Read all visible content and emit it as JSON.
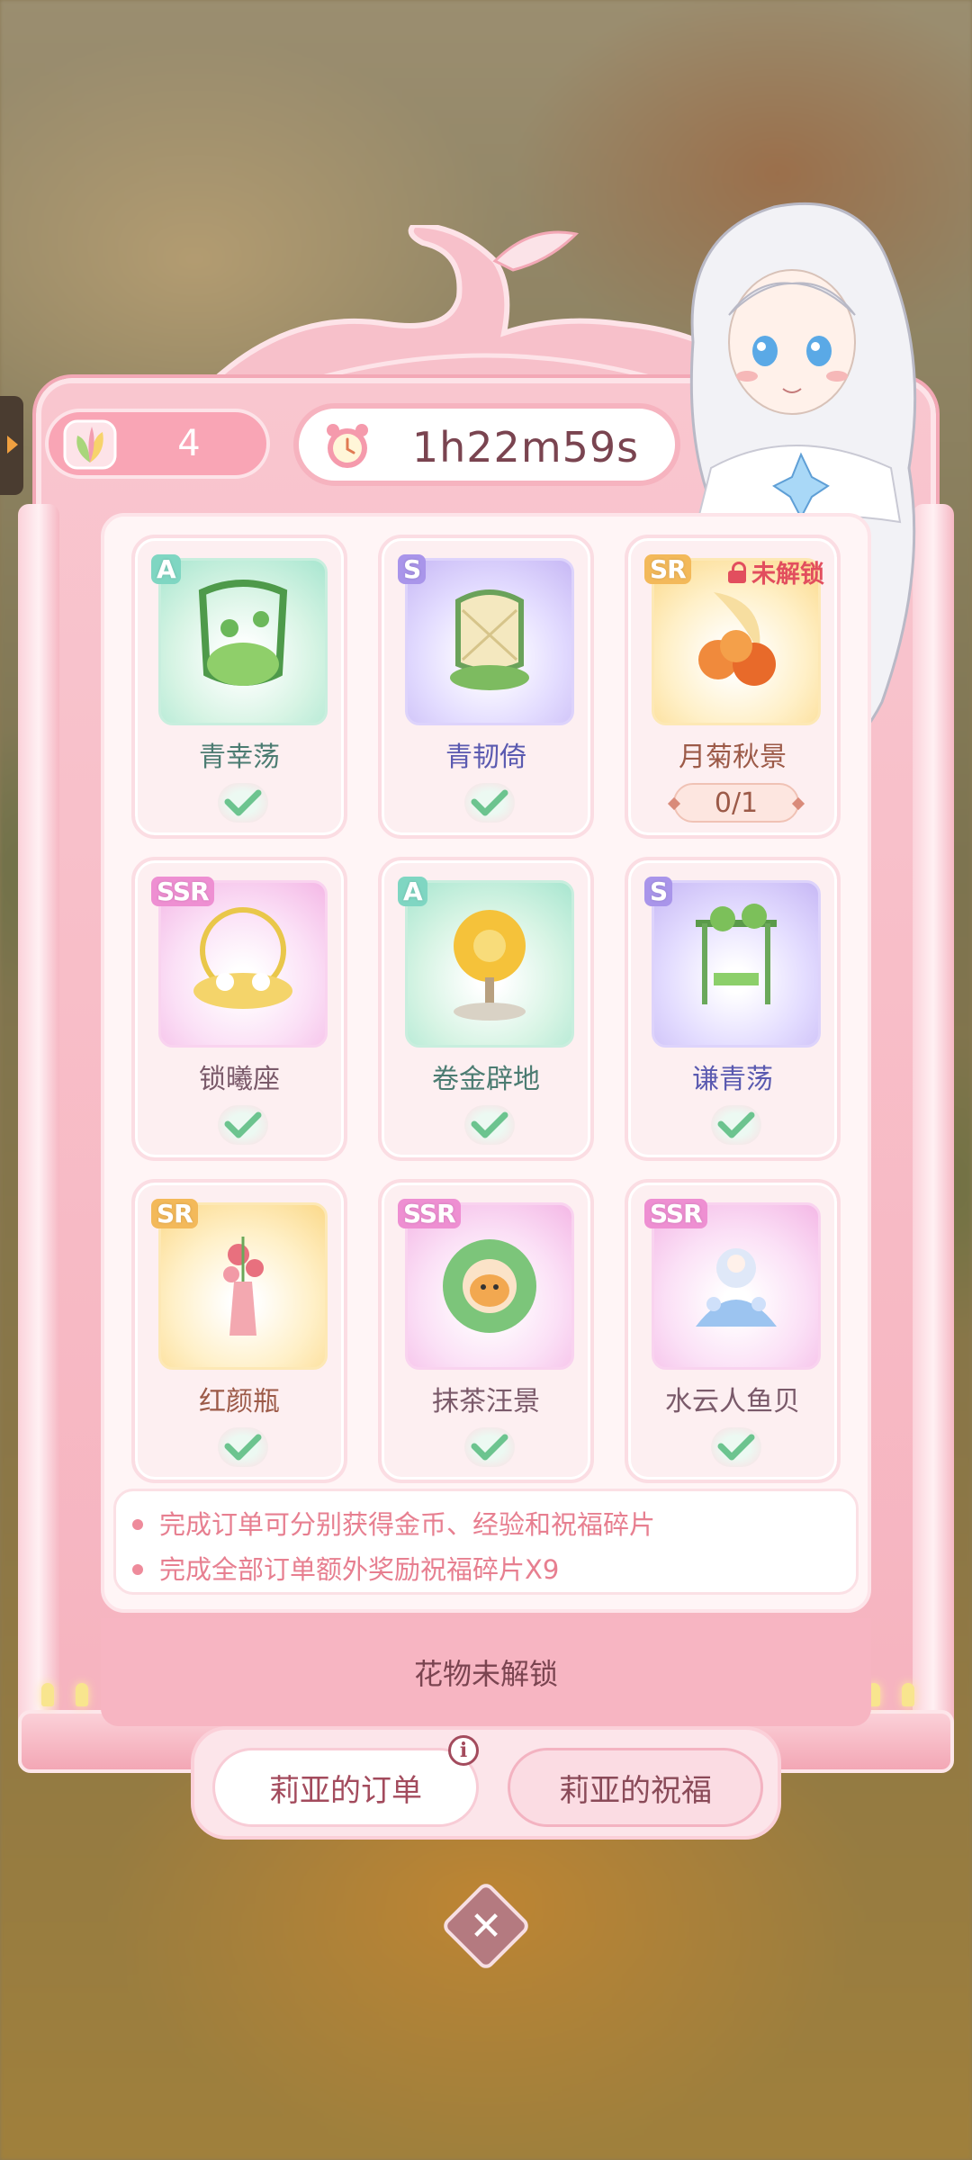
{
  "top_bar": {
    "petal_count": "4",
    "timer": "1h22m59s"
  },
  "orders": [
    {
      "rarity": "A",
      "name": "青幸荡",
      "status": "done",
      "progress": ""
    },
    {
      "rarity": "S",
      "name": "青韧倚",
      "status": "done",
      "progress": ""
    },
    {
      "rarity": "SR",
      "name": "月菊秋景",
      "status": "locked",
      "lock_label": "未解锁",
      "progress": "0/1"
    },
    {
      "rarity": "SSR",
      "name": "锁曦座",
      "status": "done",
      "progress": ""
    },
    {
      "rarity": "A",
      "name": "卷金辟地",
      "status": "done",
      "progress": ""
    },
    {
      "rarity": "S",
      "name": "谦青荡",
      "status": "done",
      "progress": ""
    },
    {
      "rarity": "SR",
      "name": "红颜瓶",
      "status": "done",
      "progress": ""
    },
    {
      "rarity": "SSR",
      "name": "抹茶汪景",
      "status": "done",
      "progress": ""
    },
    {
      "rarity": "SSR",
      "name": "水云人鱼贝",
      "status": "done",
      "progress": ""
    }
  ],
  "tips": [
    "完成订单可分别获得金币、经验和祝福碎片",
    "完成全部订单额外奖励祝福碎片X9"
  ],
  "status_text": "花物未解锁",
  "tabs": [
    {
      "label": "莉亚的订单",
      "active": true
    },
    {
      "label": "莉亚的祝福",
      "active": false
    }
  ],
  "colors": {
    "frame_pink": "#f6b3bf",
    "accent_red": "#e24e5e",
    "check_green": "#6cc48f",
    "tip_pink": "#e77f90"
  }
}
